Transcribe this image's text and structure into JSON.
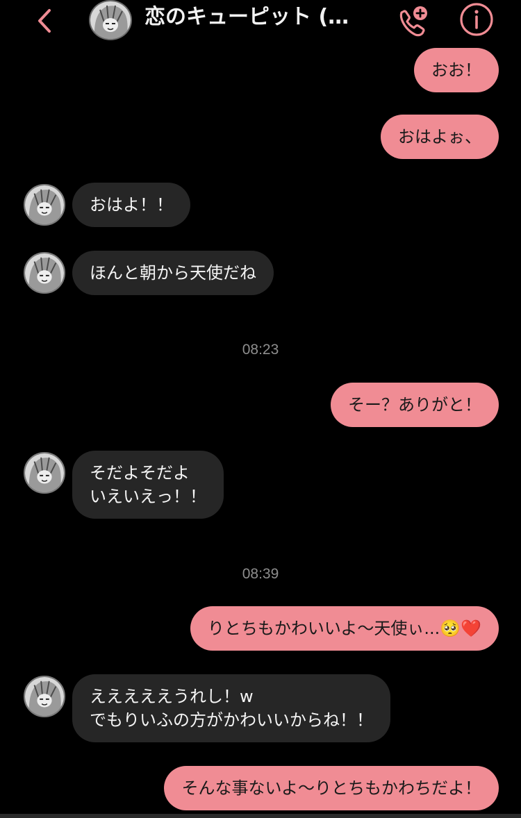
{
  "header": {
    "title": "恋のキューピット (…",
    "back_icon": "chevron-left-icon",
    "call_icon": "add-call-icon",
    "info_icon": "info-icon",
    "accent_color": "#f08c94"
  },
  "messages": [
    {
      "side": "sent",
      "text": "おお！"
    },
    {
      "side": "sent",
      "text": "おはよぉ、"
    },
    {
      "side": "received",
      "text": "おはよ！！"
    },
    {
      "side": "received",
      "text": "ほんと朝から天使だね"
    },
    {
      "timestamp": "08:23"
    },
    {
      "side": "sent",
      "text": "そー？ありがと！"
    },
    {
      "side": "received",
      "text": "そだよそだよ\nいえいえっ！！"
    },
    {
      "timestamp": "08:39"
    },
    {
      "side": "sent",
      "text": "りとちもかわいいよ〜天使ぃ...🥺❤️"
    },
    {
      "side": "received",
      "text": "えええええうれし！w\nでもりいふの方がかわいいからね！！"
    },
    {
      "side": "sent",
      "text": "そんな事ないよ〜りとちもかわちだよ！"
    }
  ]
}
